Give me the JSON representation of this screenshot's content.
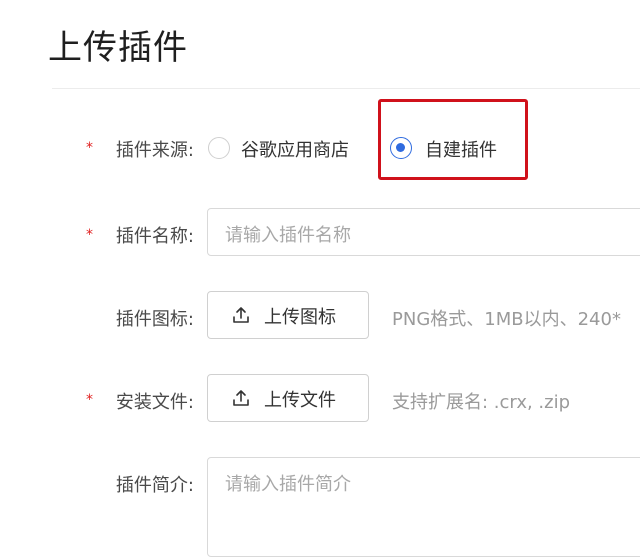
{
  "page": {
    "title": "上传插件"
  },
  "form": {
    "source": {
      "required_mark": "*",
      "label": "插件来源:",
      "options": [
        {
          "label": "谷歌应用商店",
          "selected": false
        },
        {
          "label": "自建插件",
          "selected": true
        }
      ]
    },
    "name": {
      "required_mark": "*",
      "label": "插件名称:",
      "placeholder": "请输入插件名称"
    },
    "icon": {
      "label": "插件图标:",
      "button_label": "上传图标",
      "hint": "PNG格式、1MB以内、240*"
    },
    "install_file": {
      "required_mark": "*",
      "label": "安装文件:",
      "button_label": "上传文件",
      "hint": "支持扩展名: .crx, .zip"
    },
    "intro": {
      "label": "插件简介:",
      "placeholder": "请输入插件简介"
    }
  },
  "colors": {
    "accent": "#2f6bdf",
    "required": "#e02020",
    "highlight_border": "#d0111b"
  }
}
